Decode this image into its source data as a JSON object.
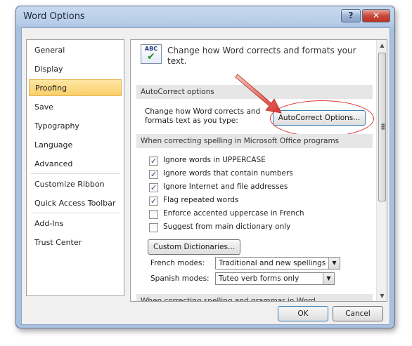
{
  "window": {
    "title": "Word Options",
    "help_label": "?",
    "close_label": "✕"
  },
  "sidebar": {
    "items": [
      {
        "label": "General"
      },
      {
        "label": "Display"
      },
      {
        "label": "Proofing"
      },
      {
        "label": "Save"
      },
      {
        "label": "Typography"
      },
      {
        "label": "Language"
      },
      {
        "label": "Advanced"
      },
      {
        "label": "Customize Ribbon"
      },
      {
        "label": "Quick Access Toolbar"
      },
      {
        "label": "Add-Ins"
      },
      {
        "label": "Trust Center"
      }
    ],
    "selected": "Proofing"
  },
  "content": {
    "icon_text": "ABC",
    "intro": "Change how Word corrects and formats your text.",
    "autocorrect_section": {
      "header": "AutoCorrect options",
      "label": "Change how Word corrects and formats text as you type:",
      "button": "AutoCorrect Options..."
    },
    "spelling_section": {
      "header": "When correcting spelling in Microsoft Office programs",
      "checkboxes": [
        {
          "label": "Ignore words in UPPERCASE",
          "checked": true,
          "mark": "✓"
        },
        {
          "label": "Ignore words that contain numbers",
          "checked": true,
          "mark": "✓"
        },
        {
          "label": "Ignore Internet and file addresses",
          "checked": true,
          "mark": "✓"
        },
        {
          "label": "Flag repeated words",
          "checked": true,
          "mark": "✓"
        },
        {
          "label": "Enforce accented uppercase in French",
          "checked": false,
          "mark": ""
        },
        {
          "label": "Suggest from main dictionary only",
          "checked": false,
          "mark": ""
        }
      ],
      "dictionaries_button": "Custom Dictionaries...",
      "french_modes": {
        "label": "French modes:",
        "value": "Traditional and new spellings"
      },
      "spanish_modes": {
        "label": "Spanish modes:",
        "value": "Tuteo verb forms only"
      }
    },
    "grammar_section": {
      "header": "When correcting spelling and grammar in Word"
    }
  },
  "footer": {
    "ok_label": "OK",
    "cancel_label": "Cancel"
  },
  "colors": {
    "selected_item": "#fbcf6a",
    "highlight_ellipse": "#d93a35"
  }
}
